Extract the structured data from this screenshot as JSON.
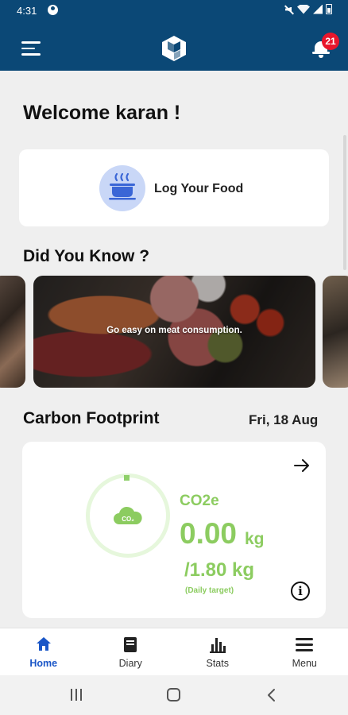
{
  "status_bar": {
    "time": "4:31"
  },
  "app_bar": {
    "notification_count": "21",
    "brand_color": "#0b4876",
    "badge_color": "#e8162c"
  },
  "welcome": {
    "text": "Welcome karan !"
  },
  "log_food": {
    "label": "Log Your Food",
    "icon": "food-dish-icon"
  },
  "did_you_know": {
    "title": "Did You Know ?",
    "active_slide_text": "Go easy on meat consumption."
  },
  "carbon": {
    "title": "Carbon Footprint",
    "date": "Fri, 18 Aug",
    "unit_label": "CO2e",
    "cloud_label": "CO₂",
    "value": "0.00",
    "value_unit": "kg",
    "target": "/1.80 kg",
    "target_note": "(Daily target)",
    "accent_color": "#8ccc60",
    "progress_fraction": 0.0
  },
  "bottom_nav": {
    "items": [
      {
        "label": "Home",
        "icon": "home-icon",
        "active": true
      },
      {
        "label": "Diary",
        "icon": "diary-icon",
        "active": false
      },
      {
        "label": "Stats",
        "icon": "stats-icon",
        "active": false
      },
      {
        "label": "Menu",
        "icon": "menu-icon",
        "active": false
      }
    ],
    "active_color": "#1a56c7"
  }
}
